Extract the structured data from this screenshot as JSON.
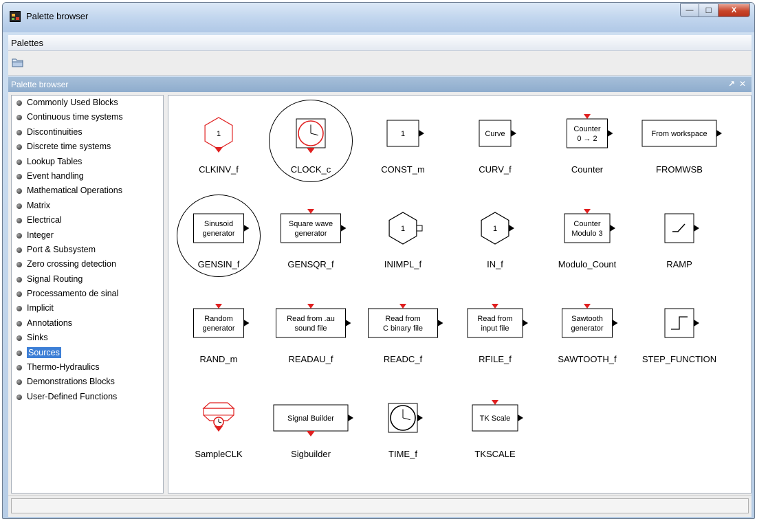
{
  "window": {
    "title": "Palette browser"
  },
  "menubar": {
    "items": [
      "Palettes"
    ]
  },
  "panel": {
    "title": "Palette browser",
    "controls": [
      "↗",
      "✕"
    ]
  },
  "window_buttons": {
    "minimize": "—",
    "maximize": "☐",
    "close": "X"
  },
  "tree": {
    "items": [
      "Commonly Used Blocks",
      "Continuous time systems",
      "Discontinuities",
      "Discrete time systems",
      "Lookup Tables",
      "Event handling",
      "Mathematical Operations",
      "Matrix",
      "Electrical",
      "Integer",
      "Port & Subsystem",
      "Zero crossing detection",
      "Signal Routing",
      "Processamento de sinal",
      "Implicit",
      "Annotations",
      "Sinks",
      "Sources",
      "Thermo-Hydraulics",
      "Demonstrations Blocks",
      "User-Defined Functions"
    ],
    "selected": "Sources"
  },
  "blocks": [
    {
      "name": "CLKINV_f",
      "icon": "hexagon-red-event-out",
      "inner": "1",
      "circled": false
    },
    {
      "name": "CLOCK_c",
      "icon": "clock-event-out",
      "inner": "",
      "circled": true
    },
    {
      "name": "CONST_m",
      "icon": "box-out",
      "inner": "1",
      "circled": false
    },
    {
      "name": "CURV_f",
      "icon": "box-out",
      "inner": "Curve",
      "circled": false
    },
    {
      "name": "Counter",
      "icon": "box-event-in-out",
      "inner": "Counter\n0 → 2",
      "circled": false
    },
    {
      "name": "FROMWSB",
      "icon": "box-out",
      "inner": "From workspace",
      "circled": false
    },
    {
      "name": "GENSIN_f",
      "icon": "box-out",
      "inner": "Sinusoid\ngenerator",
      "circled": true
    },
    {
      "name": "GENSQR_f",
      "icon": "box-event-in-out",
      "inner": "Square wave\ngenerator",
      "circled": false
    },
    {
      "name": "INIMPL_f",
      "icon": "hexagon-implicit-out",
      "inner": "1",
      "circled": false
    },
    {
      "name": "IN_f",
      "icon": "hexagon-out",
      "inner": "1",
      "circled": false
    },
    {
      "name": "Modulo_Count",
      "icon": "box-event-in-out",
      "inner": "Counter\nModulo 3",
      "circled": false
    },
    {
      "name": "RAMP",
      "icon": "ramp-out",
      "inner": "",
      "circled": false
    },
    {
      "name": "RAND_m",
      "icon": "box-event-in-out",
      "inner": "Random\ngenerator",
      "circled": false
    },
    {
      "name": "READAU_f",
      "icon": "box-event-in-out",
      "inner": "Read from .au\nsound file",
      "circled": false
    },
    {
      "name": "READC_f",
      "icon": "box-event-in-out",
      "inner": "Read from\nC binary file",
      "circled": false
    },
    {
      "name": "RFILE_f",
      "icon": "box-event-in-out",
      "inner": "Read from\ninput file",
      "circled": false
    },
    {
      "name": "SAWTOOTH_f",
      "icon": "box-event-in-out",
      "inner": "Sawtooth\ngenerator",
      "circled": false
    },
    {
      "name": "STEP_FUNCTION",
      "icon": "step-out",
      "inner": "",
      "circled": false
    },
    {
      "name": "SampleCLK",
      "icon": "sampleclk",
      "inner": "",
      "circled": false
    },
    {
      "name": "Sigbuilder",
      "icon": "box-event-out",
      "inner": "Signal Builder",
      "circled": false
    },
    {
      "name": "TIME_f",
      "icon": "time-out",
      "inner": "",
      "circled": false
    },
    {
      "name": "TKSCALE",
      "icon": "box-event-in-out",
      "inner": "TK Scale",
      "circled": false
    }
  ],
  "colors": {
    "event_port": "#e02020",
    "selection": "#3d7fd6",
    "panel_header": "#99b4d1"
  }
}
